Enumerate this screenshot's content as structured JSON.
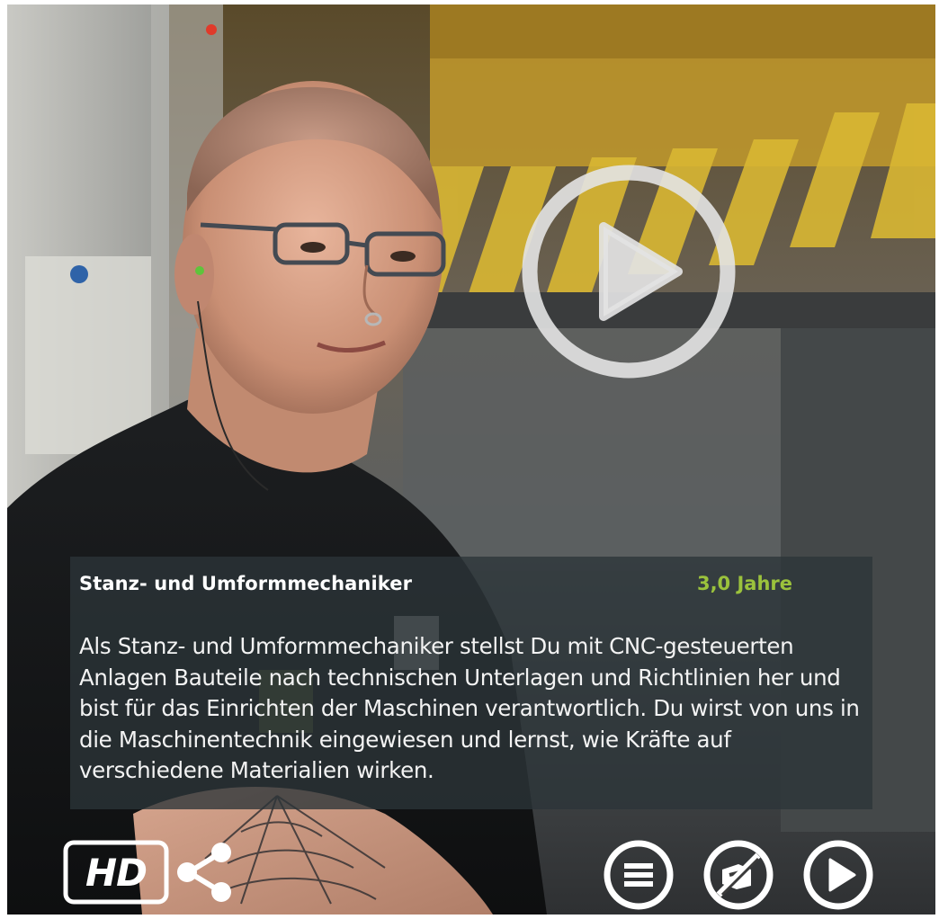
{
  "player": {
    "title": "Stanz- und Umformmechaniker",
    "duration": "3,0 Jahre",
    "description": "Als Stanz- und Umformmechaniker stellst Du mit CNC-gesteuerten Anlagen Bauteile nach technischen Unterlagen und Richtlinien her und bist für das Einrichten der Maschinen verantwortlich. Du wirst von uns in die Maschinentechnik eingewiesen und lernst, wie Kräfte auf verschiedene Materialien wirken."
  },
  "controls": {
    "hd_label": "HD",
    "big_play_icon": "play-circle-icon",
    "share_icon": "share-icon",
    "menu_icon": "menu-icon",
    "subtitles_off_icon": "no-subtitles-icon",
    "play_icon": "play-icon"
  },
  "colors": {
    "accent_green": "#9bc23c",
    "overlay": "#2c3438",
    "icon_white": "#ffffff"
  }
}
